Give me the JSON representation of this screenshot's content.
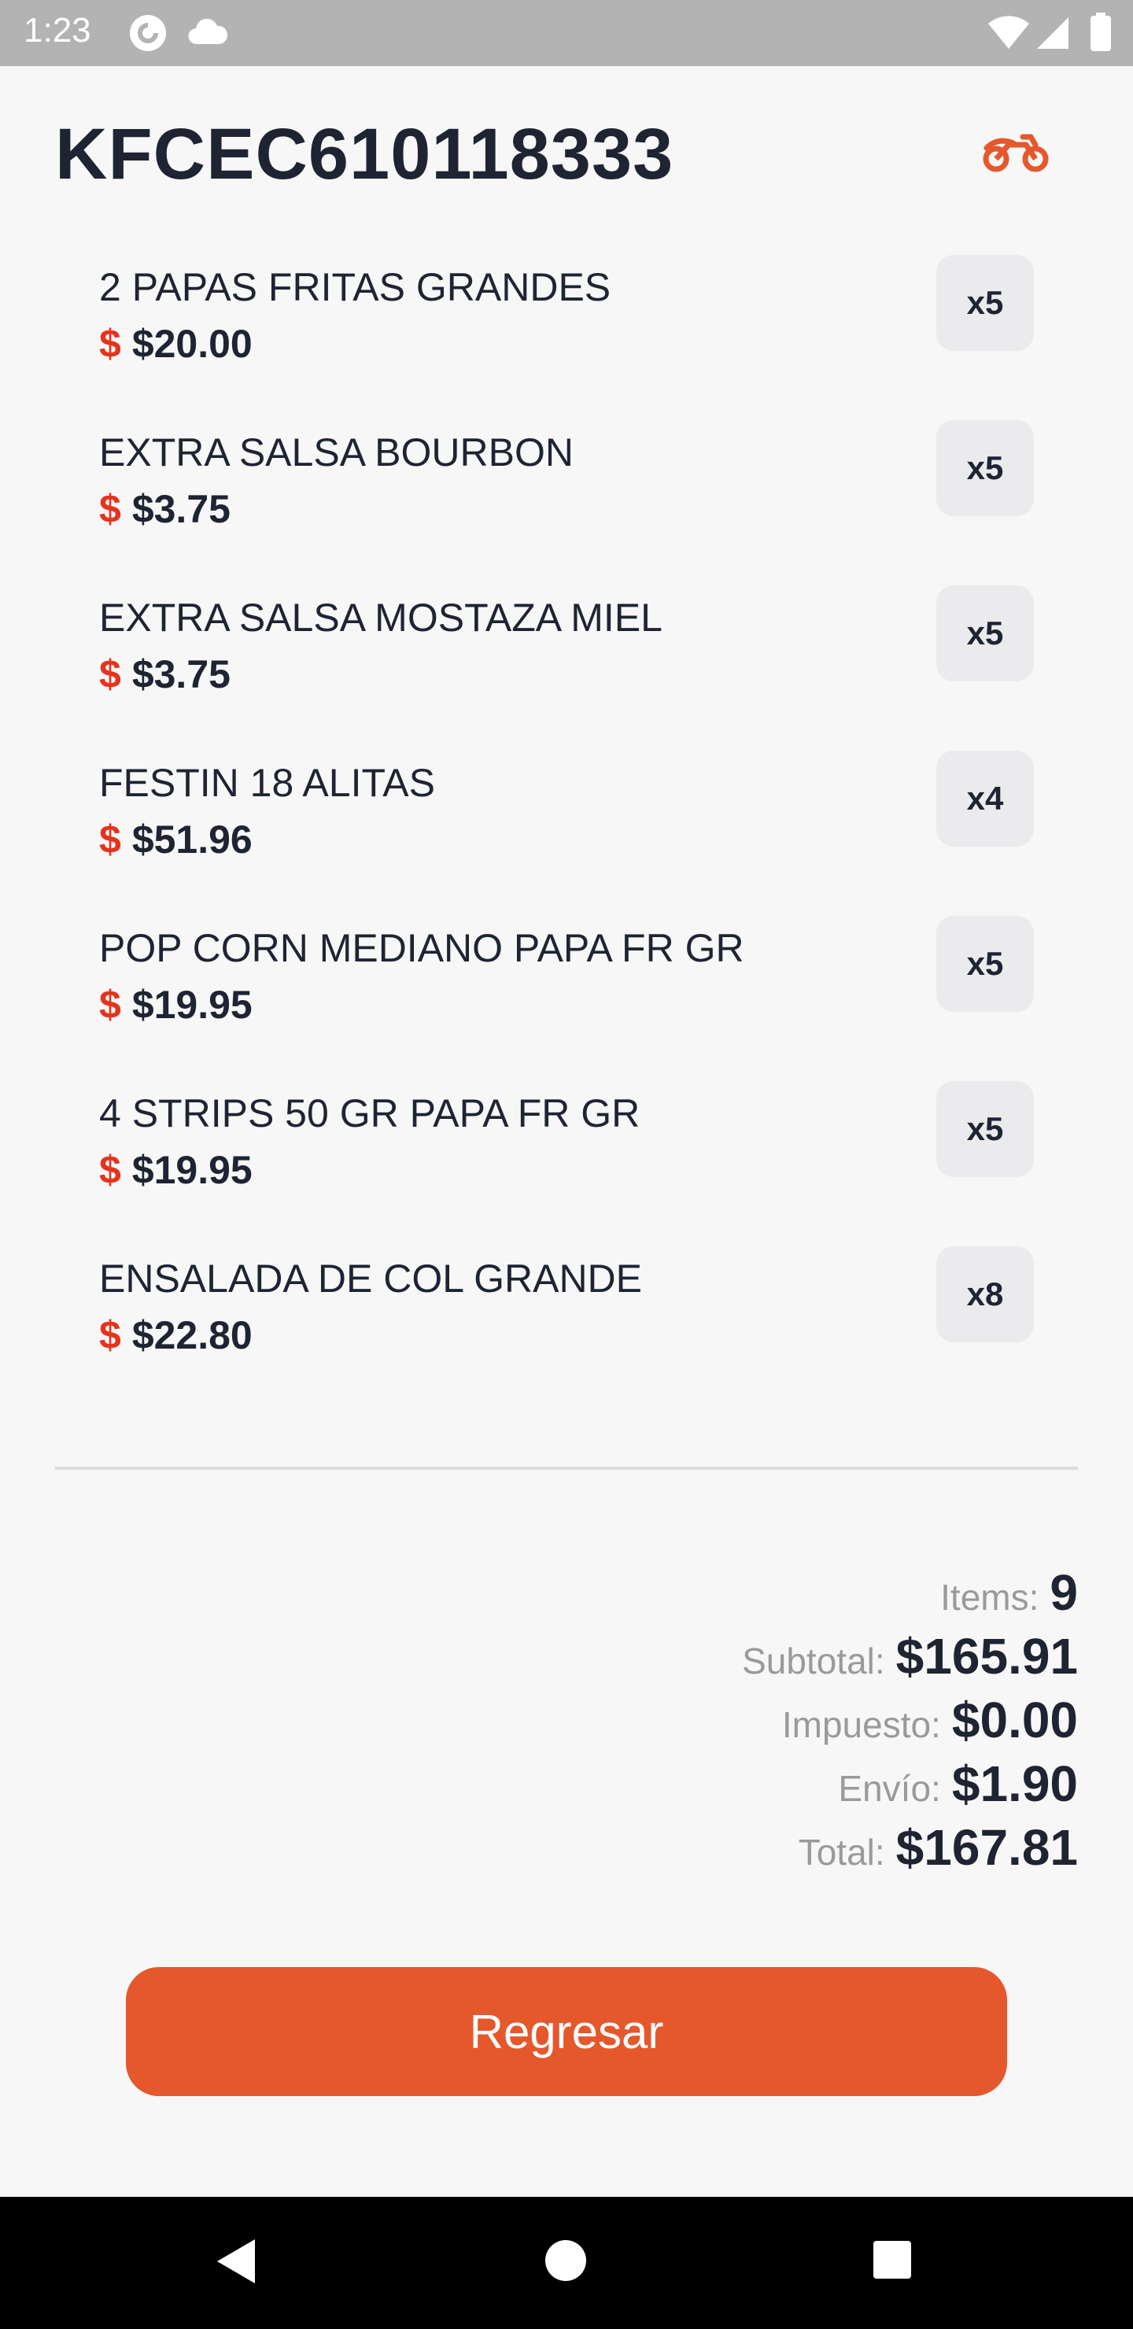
{
  "status_bar": {
    "time": "1:23",
    "icons": [
      "pocket-casts-icon",
      "cloud-icon",
      "wifi-icon",
      "signal-icon",
      "battery-icon"
    ]
  },
  "order": {
    "code": "KFCEC610118333",
    "header_icon": "motorcycle-icon"
  },
  "items": [
    {
      "name": "2 PAPAS FRITAS GRANDES",
      "currency": "$",
      "price": "$20.00",
      "qty": "x5"
    },
    {
      "name": "EXTRA SALSA BOURBON",
      "currency": "$",
      "price": "$3.75",
      "qty": "x5"
    },
    {
      "name": "EXTRA SALSA MOSTAZA MIEL",
      "currency": "$",
      "price": "$3.75",
      "qty": "x5"
    },
    {
      "name": "FESTIN 18 ALITAS",
      "currency": "$",
      "price": "$51.96",
      "qty": "x4"
    },
    {
      "name": "POP CORN MEDIANO PAPA FR GR",
      "currency": "$",
      "price": "$19.95",
      "qty": "x5"
    },
    {
      "name": "4 STRIPS 50 GR PAPA FR GR",
      "currency": "$",
      "price": "$19.95",
      "qty": "x5"
    },
    {
      "name": "ENSALADA DE COL GRANDE",
      "currency": "$",
      "price": "$22.80",
      "qty": "x8"
    }
  ],
  "summary": {
    "items_label": "Items:",
    "items_value": "9",
    "subtotal_label": "Subtotal:",
    "subtotal_value": "$165.91",
    "tax_label": "Impuesto:",
    "tax_value": "$0.00",
    "shipping_label": "Envío:",
    "shipping_value": "$1.90",
    "total_label": "Total:",
    "total_value": "$167.81"
  },
  "actions": {
    "back_label": "Regresar"
  },
  "nav_bar": {
    "buttons": [
      "back-icon",
      "home-icon",
      "recents-icon"
    ]
  },
  "colors": {
    "accent": "#e5582c",
    "currency_symbol": "#e5331e",
    "title_text": "#1f2433",
    "muted_text": "#9a9a9a",
    "badge_bg": "#ebebed"
  }
}
